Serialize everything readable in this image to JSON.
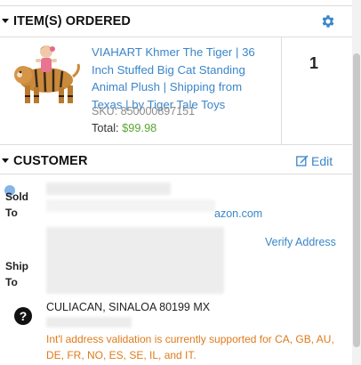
{
  "items_section": {
    "title": "ITEM(S) ORDERED",
    "product": {
      "name": "VIAHART Khmer The Tiger | 36 Inch Stuffed Big Cat Standing Animal Plush | Shipping from Texas | by Tiger Tale Toys",
      "sku": "SKU: 850000897151",
      "total_label": "Total:",
      "total_value": "$99.98",
      "quantity": "1"
    }
  },
  "customer_section": {
    "title": "CUSTOMER",
    "edit_label": "Edit",
    "sold_to_label_1": "Sold",
    "sold_to_label_2": "To",
    "email_partial": "azon.com",
    "verify_address": "Verify Address",
    "ship_to_label_1": "Ship",
    "ship_to_label_2": "To",
    "city_line": "CULIACAN, SINALOA 80199 MX",
    "help_icon_glyph": "?",
    "validation_note": "Int'l address validation is currently supported for CA, GB, AU, DE, FR, NO, ES, SE, IL, and IT."
  },
  "colors": {
    "link": "#3b86c9",
    "price": "#5aa633",
    "warning": "#e07a1a"
  },
  "icons": [
    "gear-icon",
    "caret-down-icon",
    "edit-icon",
    "help-icon",
    "product-image"
  ]
}
